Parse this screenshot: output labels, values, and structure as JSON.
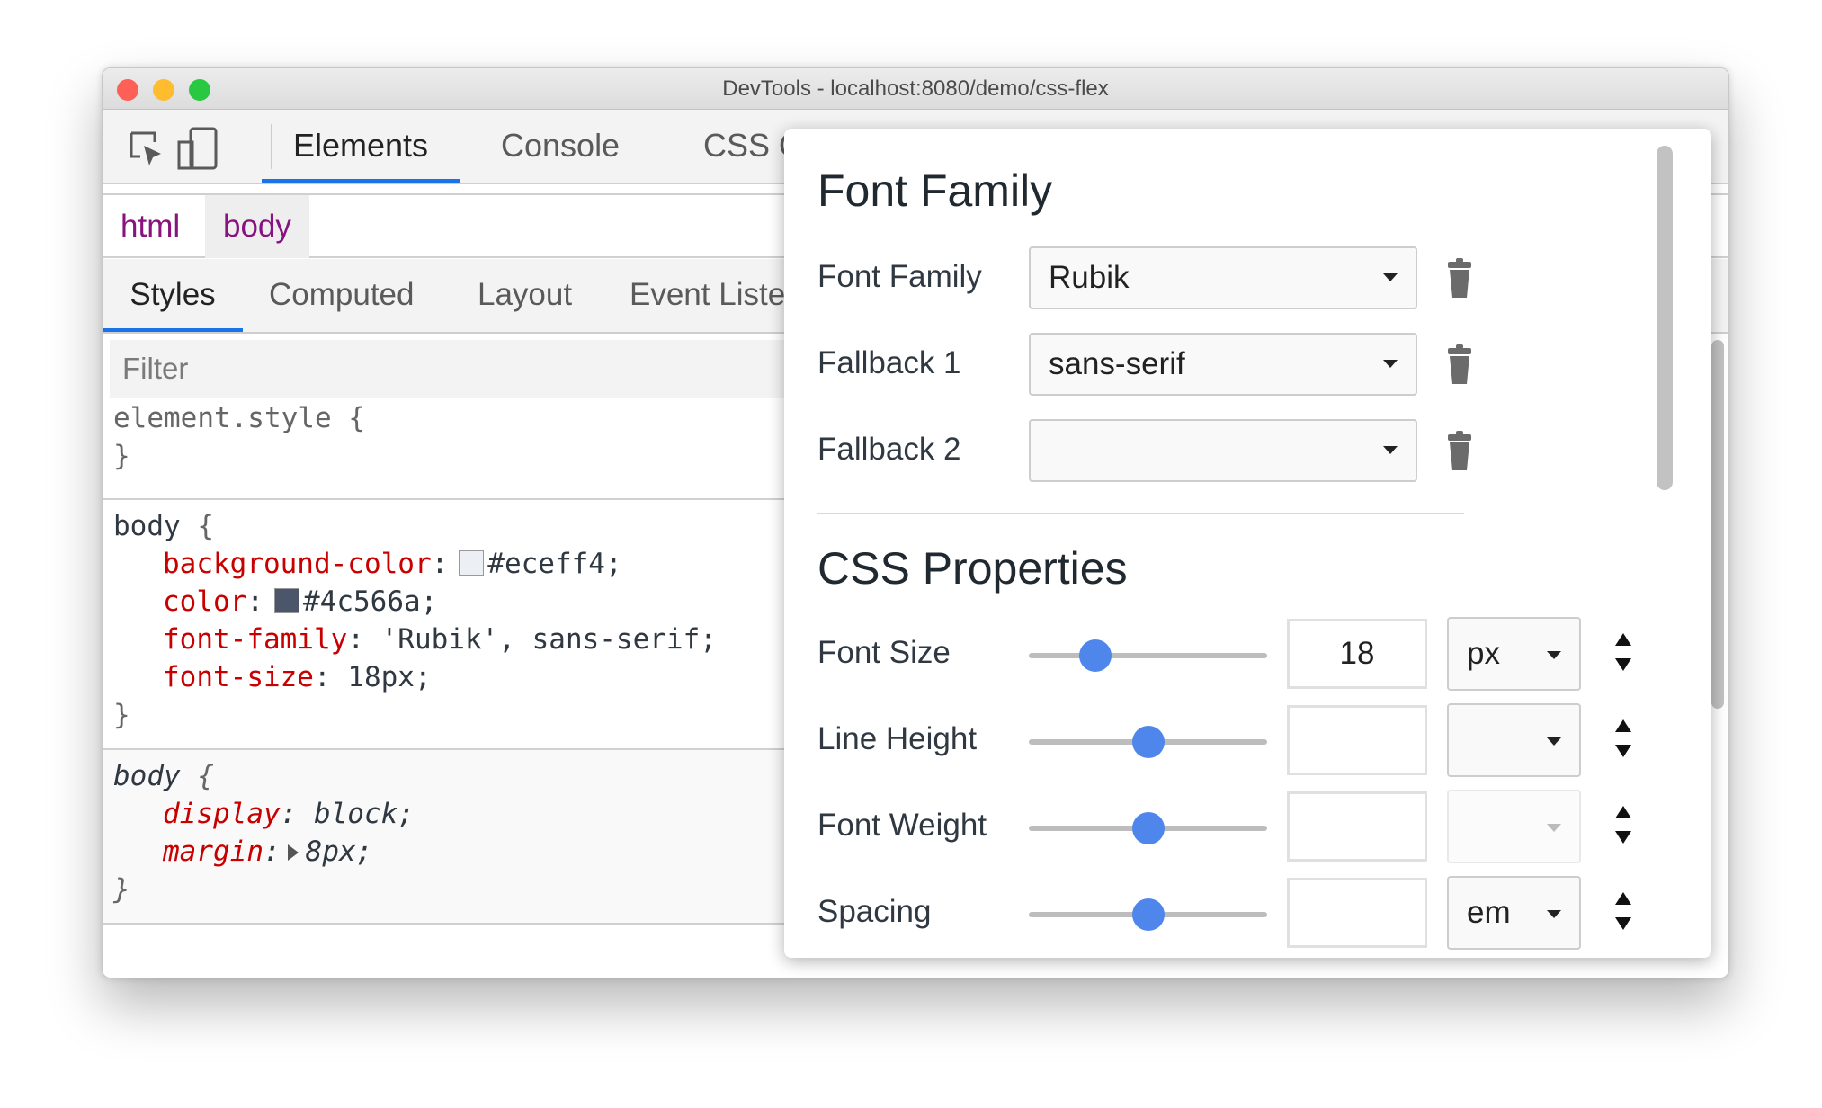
{
  "window": {
    "title": "DevTools - localhost:8080/demo/css-flex"
  },
  "toolbar": {
    "tabs": [
      {
        "label": "Elements",
        "active": true
      },
      {
        "label": "Console"
      },
      {
        "label": "CSS Overview"
      }
    ],
    "icons": [
      "inspect-element-icon",
      "device-toolbar-icon"
    ]
  },
  "breadcrumb": [
    "html",
    "body"
  ],
  "subtabs": [
    {
      "label": "Styles",
      "active": true
    },
    {
      "label": "Computed"
    },
    {
      "label": "Layout"
    },
    {
      "label": "Event Listeners"
    }
  ],
  "filter": {
    "placeholder": "Filter"
  },
  "rules": {
    "element_style": {
      "selector": "element.style {",
      "close": "}"
    },
    "body": {
      "selector": "body",
      "open": " {",
      "close": "}",
      "props": [
        {
          "name": "background-color",
          "value": "#eceff4;",
          "swatch": "#eceff4"
        },
        {
          "name": "color",
          "value": "#4c566a;",
          "swatch": "#4c566a"
        },
        {
          "name": "font-family",
          "value": "'Rubik', sans-serif;"
        },
        {
          "name": "font-size",
          "value": "18px;"
        }
      ]
    },
    "body_ua": {
      "selector": "body",
      "open": " {",
      "close": "}",
      "props": [
        {
          "name": "display",
          "value": "block;"
        },
        {
          "name": "margin",
          "value": "8px;"
        }
      ]
    }
  },
  "font_editor": {
    "font_family_heading": "Font Family",
    "families": [
      {
        "label": "Font Family",
        "value": "Rubik"
      },
      {
        "label": "Fallback 1",
        "value": "sans-serif"
      },
      {
        "label": "Fallback 2",
        "value": ""
      }
    ],
    "css_heading": "CSS Properties",
    "properties": [
      {
        "label": "Font Size",
        "value": "18",
        "unit": "px",
        "slider": 0.28,
        "unit_enabled": true
      },
      {
        "label": "Line Height",
        "value": "",
        "unit": "",
        "slider": 0.5,
        "unit_enabled": true
      },
      {
        "label": "Font Weight",
        "value": "",
        "unit": "",
        "slider": 0.5,
        "unit_enabled": false
      },
      {
        "label": "Spacing",
        "value": "",
        "unit": "em",
        "slider": 0.5,
        "unit_enabled": true
      }
    ],
    "accent": "#4f86ec"
  }
}
